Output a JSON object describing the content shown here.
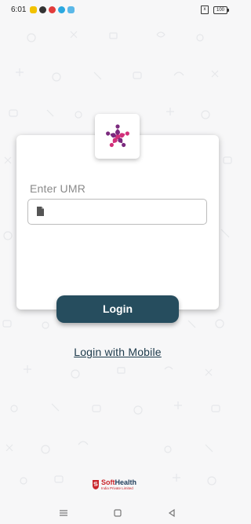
{
  "status_bar": {
    "time": "6:01",
    "sim_label": "x",
    "battery_label": "100",
    "notification_colors": [
      "#f2c200",
      "#333333",
      "#e23b3b",
      "#2aa8e0",
      "#5bb8e8"
    ]
  },
  "login_card": {
    "logo": "flower-people-logo",
    "umr_label": "Enter UMR",
    "umr_value": "",
    "umr_placeholder": "",
    "field_icon": "document-icon",
    "login_button": "Login"
  },
  "alt_login": {
    "mobile_link": "Login with Mobile"
  },
  "footer": {
    "brand_name_a": "Soft",
    "brand_name_b": "Health",
    "brand_tagline": "India Private Limited",
    "brand_icon": "s-shield-icon"
  },
  "nav": {
    "items": [
      "menu-icon",
      "home-icon",
      "back-icon"
    ]
  },
  "colors": {
    "primary": "#264d5e",
    "link": "#1d3a4b",
    "brand_red": "#c8252b",
    "brand_blue": "#1e3c5a",
    "logo_purple": "#7b2a7e",
    "logo_pink": "#d1307a"
  }
}
